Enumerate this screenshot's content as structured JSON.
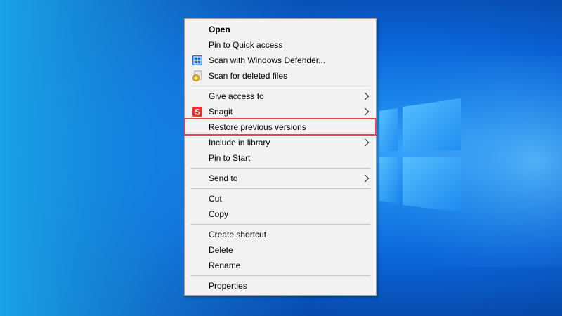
{
  "colors": {
    "menu_bg": "#f2f2f2",
    "highlight_border": "#e64550",
    "desktop_blue": "#0a63d6"
  },
  "menu": {
    "groups": [
      [
        {
          "label": "Open",
          "bold": true,
          "icon": null,
          "submenu": false
        },
        {
          "label": "Pin to Quick access",
          "icon": null,
          "submenu": false
        },
        {
          "label": "Scan with Windows Defender...",
          "icon": "windows-defender-icon",
          "submenu": false
        },
        {
          "label": "Scan for deleted files",
          "icon": "file-recovery-icon",
          "submenu": false
        }
      ],
      [
        {
          "label": "Give access to",
          "icon": null,
          "submenu": true
        },
        {
          "label": "Snagit",
          "icon": "snagit-icon",
          "submenu": true
        },
        {
          "label": "Restore previous versions",
          "icon": null,
          "submenu": false,
          "highlighted": true
        },
        {
          "label": "Include in library",
          "icon": null,
          "submenu": true
        },
        {
          "label": "Pin to Start",
          "icon": null,
          "submenu": false
        }
      ],
      [
        {
          "label": "Send to",
          "icon": null,
          "submenu": true
        }
      ],
      [
        {
          "label": "Cut",
          "icon": null,
          "submenu": false
        },
        {
          "label": "Copy",
          "icon": null,
          "submenu": false
        }
      ],
      [
        {
          "label": "Create shortcut",
          "icon": null,
          "submenu": false
        },
        {
          "label": "Delete",
          "icon": null,
          "submenu": false
        },
        {
          "label": "Rename",
          "icon": null,
          "submenu": false
        }
      ],
      [
        {
          "label": "Properties",
          "icon": null,
          "submenu": false
        }
      ]
    ]
  }
}
